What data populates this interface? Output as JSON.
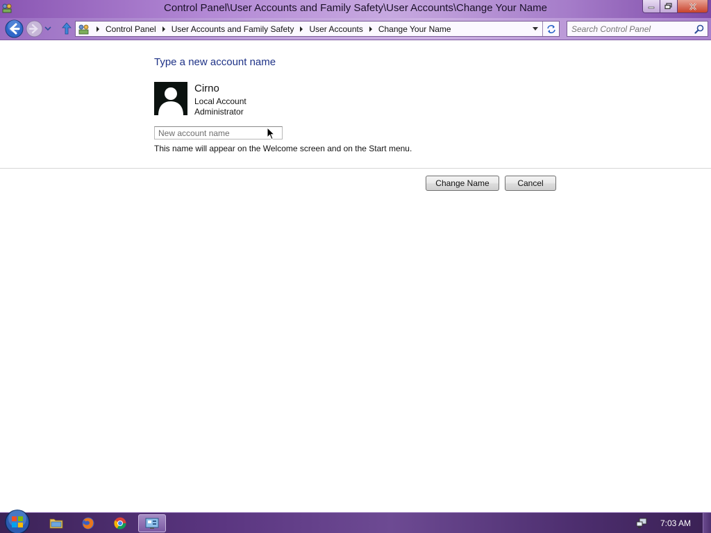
{
  "window": {
    "title": "Control Panel\\User Accounts and Family Safety\\User Accounts\\Change Your Name"
  },
  "address_bar": {
    "crumbs": [
      "Control Panel",
      "User Accounts and Family Safety",
      "User Accounts",
      "Change Your Name"
    ]
  },
  "search": {
    "placeholder": "Search Control Panel"
  },
  "main": {
    "heading": "Type a new account name",
    "user": {
      "name": "Cirno",
      "account_type": "Local Account",
      "role": "Administrator"
    },
    "name_input": {
      "placeholder": "New account name",
      "value": ""
    },
    "hint": "This name will appear on the Welcome screen and on the Start menu.",
    "change_button": "Change Name",
    "cancel_button": "Cancel"
  },
  "taskbar": {
    "items": [
      "explorer",
      "firefox",
      "chrome",
      "control-panel"
    ],
    "active_item": "control-panel",
    "clock": "7:03 AM"
  },
  "colors": {
    "heading": "#1e3287",
    "frame_accent": "#9a6dc2"
  }
}
